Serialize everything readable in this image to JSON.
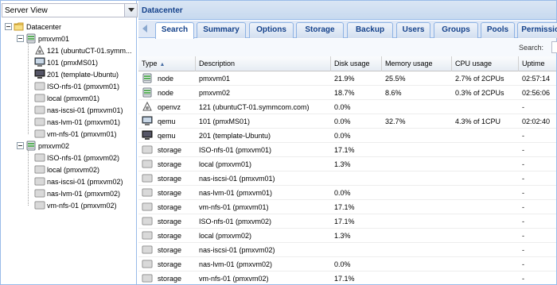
{
  "server_view": {
    "value": "Server View"
  },
  "tree": {
    "root": "Datacenter",
    "nodes": [
      {
        "label": "pmxvm01",
        "children": [
          {
            "label": "121 (ubuntuCT-01.symm...",
            "icon": "container-icon"
          },
          {
            "label": "101 (pmxMS01)",
            "icon": "vm-icon"
          },
          {
            "label": "201 (template-Ubuntu)",
            "icon": "vm-template-icon"
          },
          {
            "label": "ISO-nfs-01 (pmxvm01)",
            "icon": "storage-icon"
          },
          {
            "label": "local (pmxvm01)",
            "icon": "storage-icon"
          },
          {
            "label": "nas-iscsi-01 (pmxvm01)",
            "icon": "storage-icon"
          },
          {
            "label": "nas-lvm-01 (pmxvm01)",
            "icon": "storage-icon"
          },
          {
            "label": "vm-nfs-01 (pmxvm01)",
            "icon": "storage-icon"
          }
        ]
      },
      {
        "label": "pmxvm02",
        "children": [
          {
            "label": "ISO-nfs-01 (pmxvm02)",
            "icon": "storage-icon"
          },
          {
            "label": "local (pmxvm02)",
            "icon": "storage-icon"
          },
          {
            "label": "nas-iscsi-01 (pmxvm02)",
            "icon": "storage-icon"
          },
          {
            "label": "nas-lvm-01 (pmxvm02)",
            "icon": "storage-icon"
          },
          {
            "label": "vm-nfs-01 (pmxvm02)",
            "icon": "storage-icon"
          }
        ]
      }
    ]
  },
  "panel_title": "Datacenter",
  "tabs": [
    "Search",
    "Summary",
    "Options",
    "Storage",
    "Backup",
    "Users",
    "Groups",
    "Pools",
    "Permissions"
  ],
  "active_tab": "Search",
  "search": {
    "label": "Search:",
    "value": ""
  },
  "grid": {
    "columns": [
      "Type",
      "Description",
      "Disk usage",
      "Memory usage",
      "CPU usage",
      "Uptime"
    ],
    "sort_indicator": "▲",
    "rows": [
      {
        "type": "node",
        "icon": "node-icon",
        "desc": "pmxvm01",
        "disk": "21.9%",
        "mem": "25.5%",
        "cpu": "2.7% of 2CPUs",
        "uptime": "02:57:14"
      },
      {
        "type": "node",
        "icon": "node-icon",
        "desc": "pmxvm02",
        "disk": "18.7%",
        "mem": "8.6%",
        "cpu": "0.3% of 2CPUs",
        "uptime": "02:56:06"
      },
      {
        "type": "openvz",
        "icon": "container-icon",
        "desc": "121 (ubuntuCT-01.symmcom.com)",
        "disk": "0.0%",
        "mem": "",
        "cpu": "",
        "uptime": "-"
      },
      {
        "type": "qemu",
        "icon": "vm-icon",
        "desc": "101 (pmxMS01)",
        "disk": "0.0%",
        "mem": "32.7%",
        "cpu": "4.3% of 1CPU",
        "uptime": "02:02:40"
      },
      {
        "type": "qemu",
        "icon": "vm-template-icon",
        "desc": "201 (template-Ubuntu)",
        "disk": "0.0%",
        "mem": "",
        "cpu": "",
        "uptime": "-"
      },
      {
        "type": "storage",
        "icon": "storage-icon",
        "desc": "ISO-nfs-01 (pmxvm01)",
        "disk": "17.1%",
        "mem": "",
        "cpu": "",
        "uptime": "-"
      },
      {
        "type": "storage",
        "icon": "storage-icon",
        "desc": "local (pmxvm01)",
        "disk": "1.3%",
        "mem": "",
        "cpu": "",
        "uptime": "-"
      },
      {
        "type": "storage",
        "icon": "storage-icon",
        "desc": "nas-iscsi-01 (pmxvm01)",
        "disk": "",
        "mem": "",
        "cpu": "",
        "uptime": "-"
      },
      {
        "type": "storage",
        "icon": "storage-icon",
        "desc": "nas-lvm-01 (pmxvm01)",
        "disk": "0.0%",
        "mem": "",
        "cpu": "",
        "uptime": "-"
      },
      {
        "type": "storage",
        "icon": "storage-icon",
        "desc": "vm-nfs-01 (pmxvm01)",
        "disk": "17.1%",
        "mem": "",
        "cpu": "",
        "uptime": "-"
      },
      {
        "type": "storage",
        "icon": "storage-icon",
        "desc": "ISO-nfs-01 (pmxvm02)",
        "disk": "17.1%",
        "mem": "",
        "cpu": "",
        "uptime": "-"
      },
      {
        "type": "storage",
        "icon": "storage-icon",
        "desc": "local (pmxvm02)",
        "disk": "1.3%",
        "mem": "",
        "cpu": "",
        "uptime": "-"
      },
      {
        "type": "storage",
        "icon": "storage-icon",
        "desc": "nas-iscsi-01 (pmxvm02)",
        "disk": "",
        "mem": "",
        "cpu": "",
        "uptime": "-"
      },
      {
        "type": "storage",
        "icon": "storage-icon",
        "desc": "nas-lvm-01 (pmxvm02)",
        "disk": "0.0%",
        "mem": "",
        "cpu": "",
        "uptime": "-"
      },
      {
        "type": "storage",
        "icon": "storage-icon",
        "desc": "vm-nfs-01 (pmxvm02)",
        "disk": "17.1%",
        "mem": "",
        "cpu": "",
        "uptime": "-"
      }
    ]
  },
  "colors": {
    "header_blue": "#15428b",
    "border_blue": "#99bbe8",
    "folder_yellow": "#f0c040",
    "node_green": "#3aa03a"
  }
}
